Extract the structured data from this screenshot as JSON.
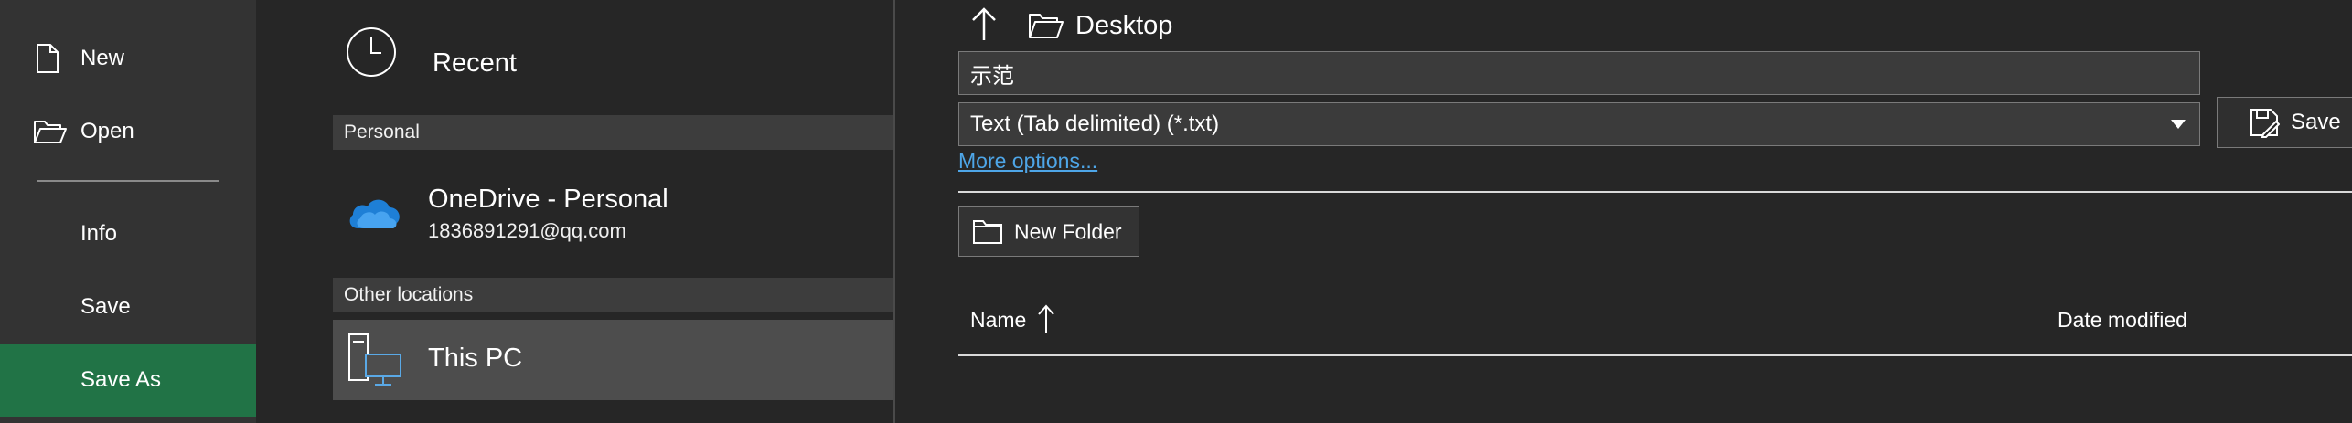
{
  "nav": {
    "items": [
      {
        "label": "New",
        "icon": "new-file-icon"
      },
      {
        "label": "Open",
        "icon": "open-folder-icon"
      },
      {
        "label": "Info"
      },
      {
        "label": "Save"
      },
      {
        "label": "Save As",
        "selected": true
      }
    ]
  },
  "locations": {
    "recent_label": "Recent",
    "personal_header": "Personal",
    "onedrive": {
      "title": "OneDrive - Personal",
      "subtitle": "1836891291@qq.com"
    },
    "other_header": "Other locations",
    "this_pc": {
      "title": "This PC",
      "selected": true
    }
  },
  "save_panel": {
    "breadcrumb": "Desktop",
    "filename": "示范",
    "file_type": "Text (Tab delimited) (*.txt)",
    "save_label": "Save",
    "more_options": "More options...",
    "new_folder": "New Folder",
    "columns": {
      "name": "Name",
      "date_modified": "Date modified"
    }
  },
  "colors": {
    "accent": "#217346",
    "link": "#4ea6e8",
    "background": "#262626",
    "nav_background": "#333333",
    "selected_location": "#4d4d4d"
  }
}
